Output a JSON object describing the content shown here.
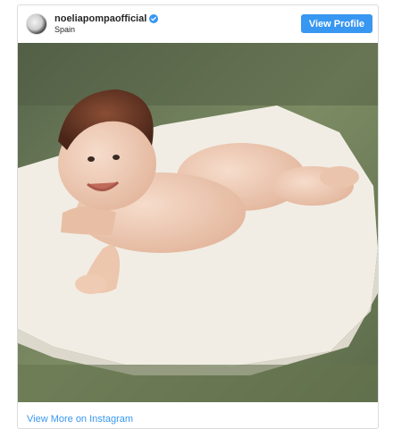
{
  "post": {
    "username": "noeliapompaofficial",
    "location": "Spain",
    "view_profile_label": "View Profile",
    "view_more_label": "View More on Instagram"
  },
  "colors": {
    "accent": "#3897f0",
    "verified": "#3897f0",
    "grass": "#6e7e5c",
    "blanket": "#f1ede4"
  },
  "icons": {
    "verified": "verified-badge-icon",
    "avatar": "profile-avatar"
  }
}
